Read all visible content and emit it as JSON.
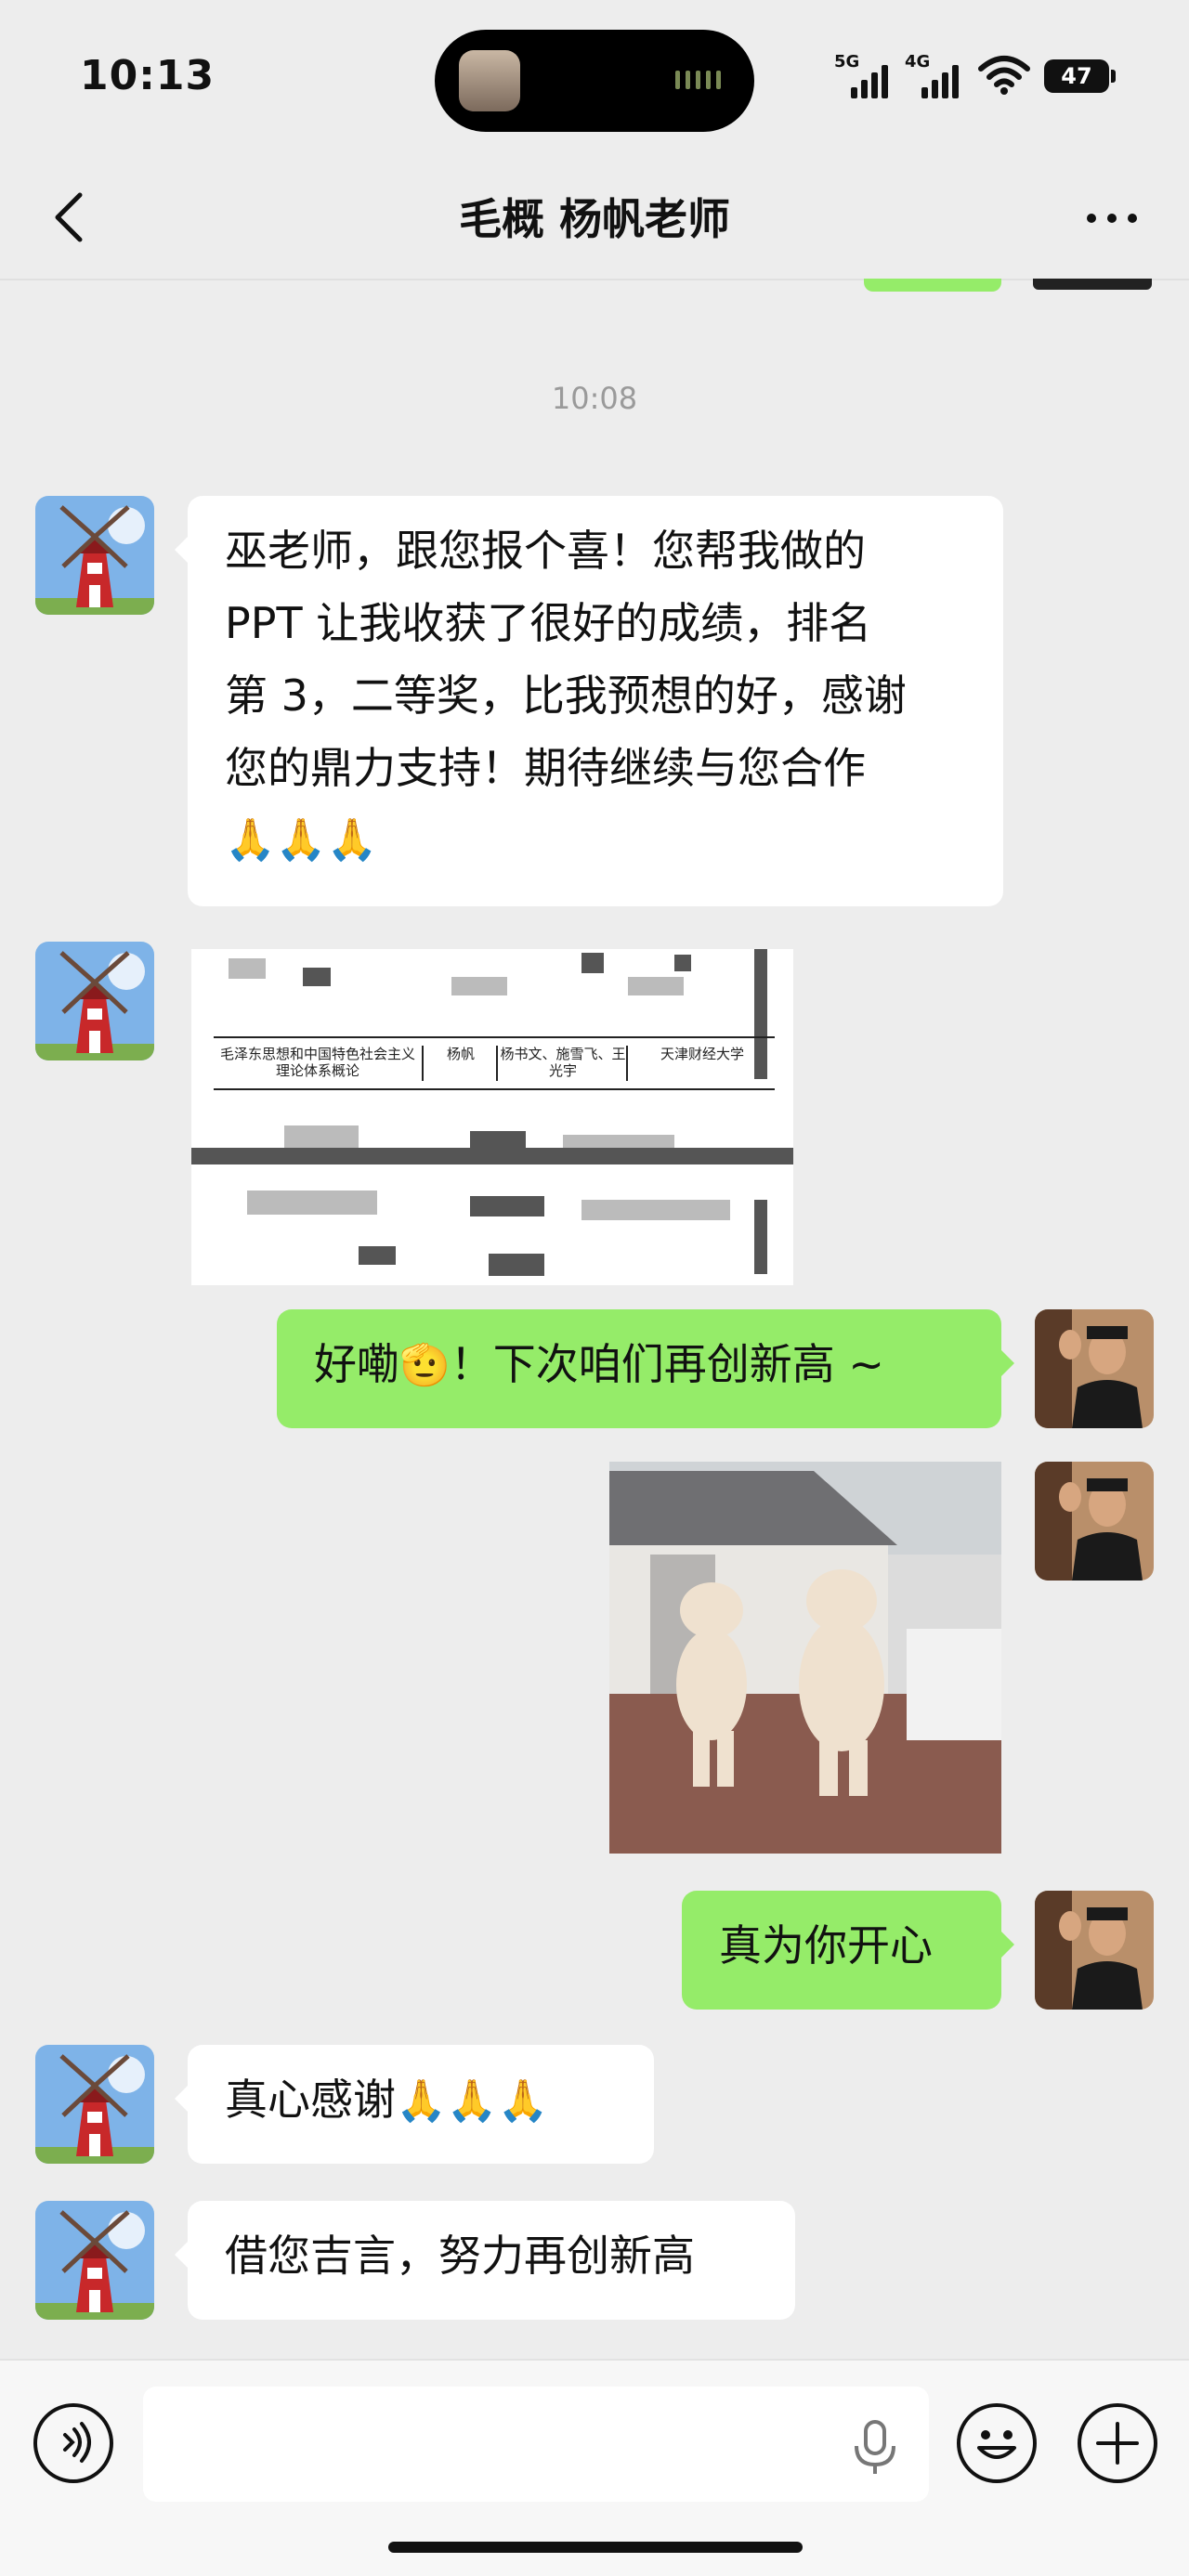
{
  "status_bar": {
    "time": "10:13",
    "signal_1": "5G",
    "signal_2": "4G",
    "battery": "47"
  },
  "header": {
    "title": "毛概 杨帆老师",
    "back_icon": "chevron-left-icon",
    "more_icon": "more-dots-icon"
  },
  "chat": {
    "timestamp": "10:08",
    "messages": [
      {
        "side": "left",
        "type": "text",
        "lines": [
          "巫老师，跟您报个喜！您帮我做的",
          "PPT 让我收获了很好的成绩，排名",
          "第 3，二等奖，比我预想的好，感谢",
          "您的鼎力支持！期待继续与您合作"
        ],
        "emoji": "🙏🙏🙏"
      },
      {
        "side": "left",
        "type": "image",
        "cells": [
          "毛泽东思想和中国特色社会主义理论体系概论",
          "杨帆",
          "杨书文、施雪飞、王光宇",
          "天津财经大学"
        ]
      },
      {
        "side": "right",
        "type": "text",
        "text_before": "好嘞",
        "emoji": "🫡",
        "text_after": "！下次咱们再创新高 ~"
      },
      {
        "side": "right",
        "type": "image",
        "description_icon": "dancing-bears-image"
      },
      {
        "side": "right",
        "type": "text",
        "text": "真为你开心"
      },
      {
        "side": "left",
        "type": "text",
        "text": "真心感谢",
        "emoji": "🙏🙏🙏"
      },
      {
        "side": "left",
        "type": "text",
        "text": "借您吉言，努力再创新高"
      }
    ]
  },
  "composer": {
    "voice_icon": "voice-icon",
    "mic_icon": "mic-icon",
    "emoji_icon": "smiley-icon",
    "plus_icon": "plus-icon"
  },
  "colors": {
    "background": "#ededed",
    "bubble_right": "#95ec69",
    "bubble_left": "#ffffff"
  }
}
